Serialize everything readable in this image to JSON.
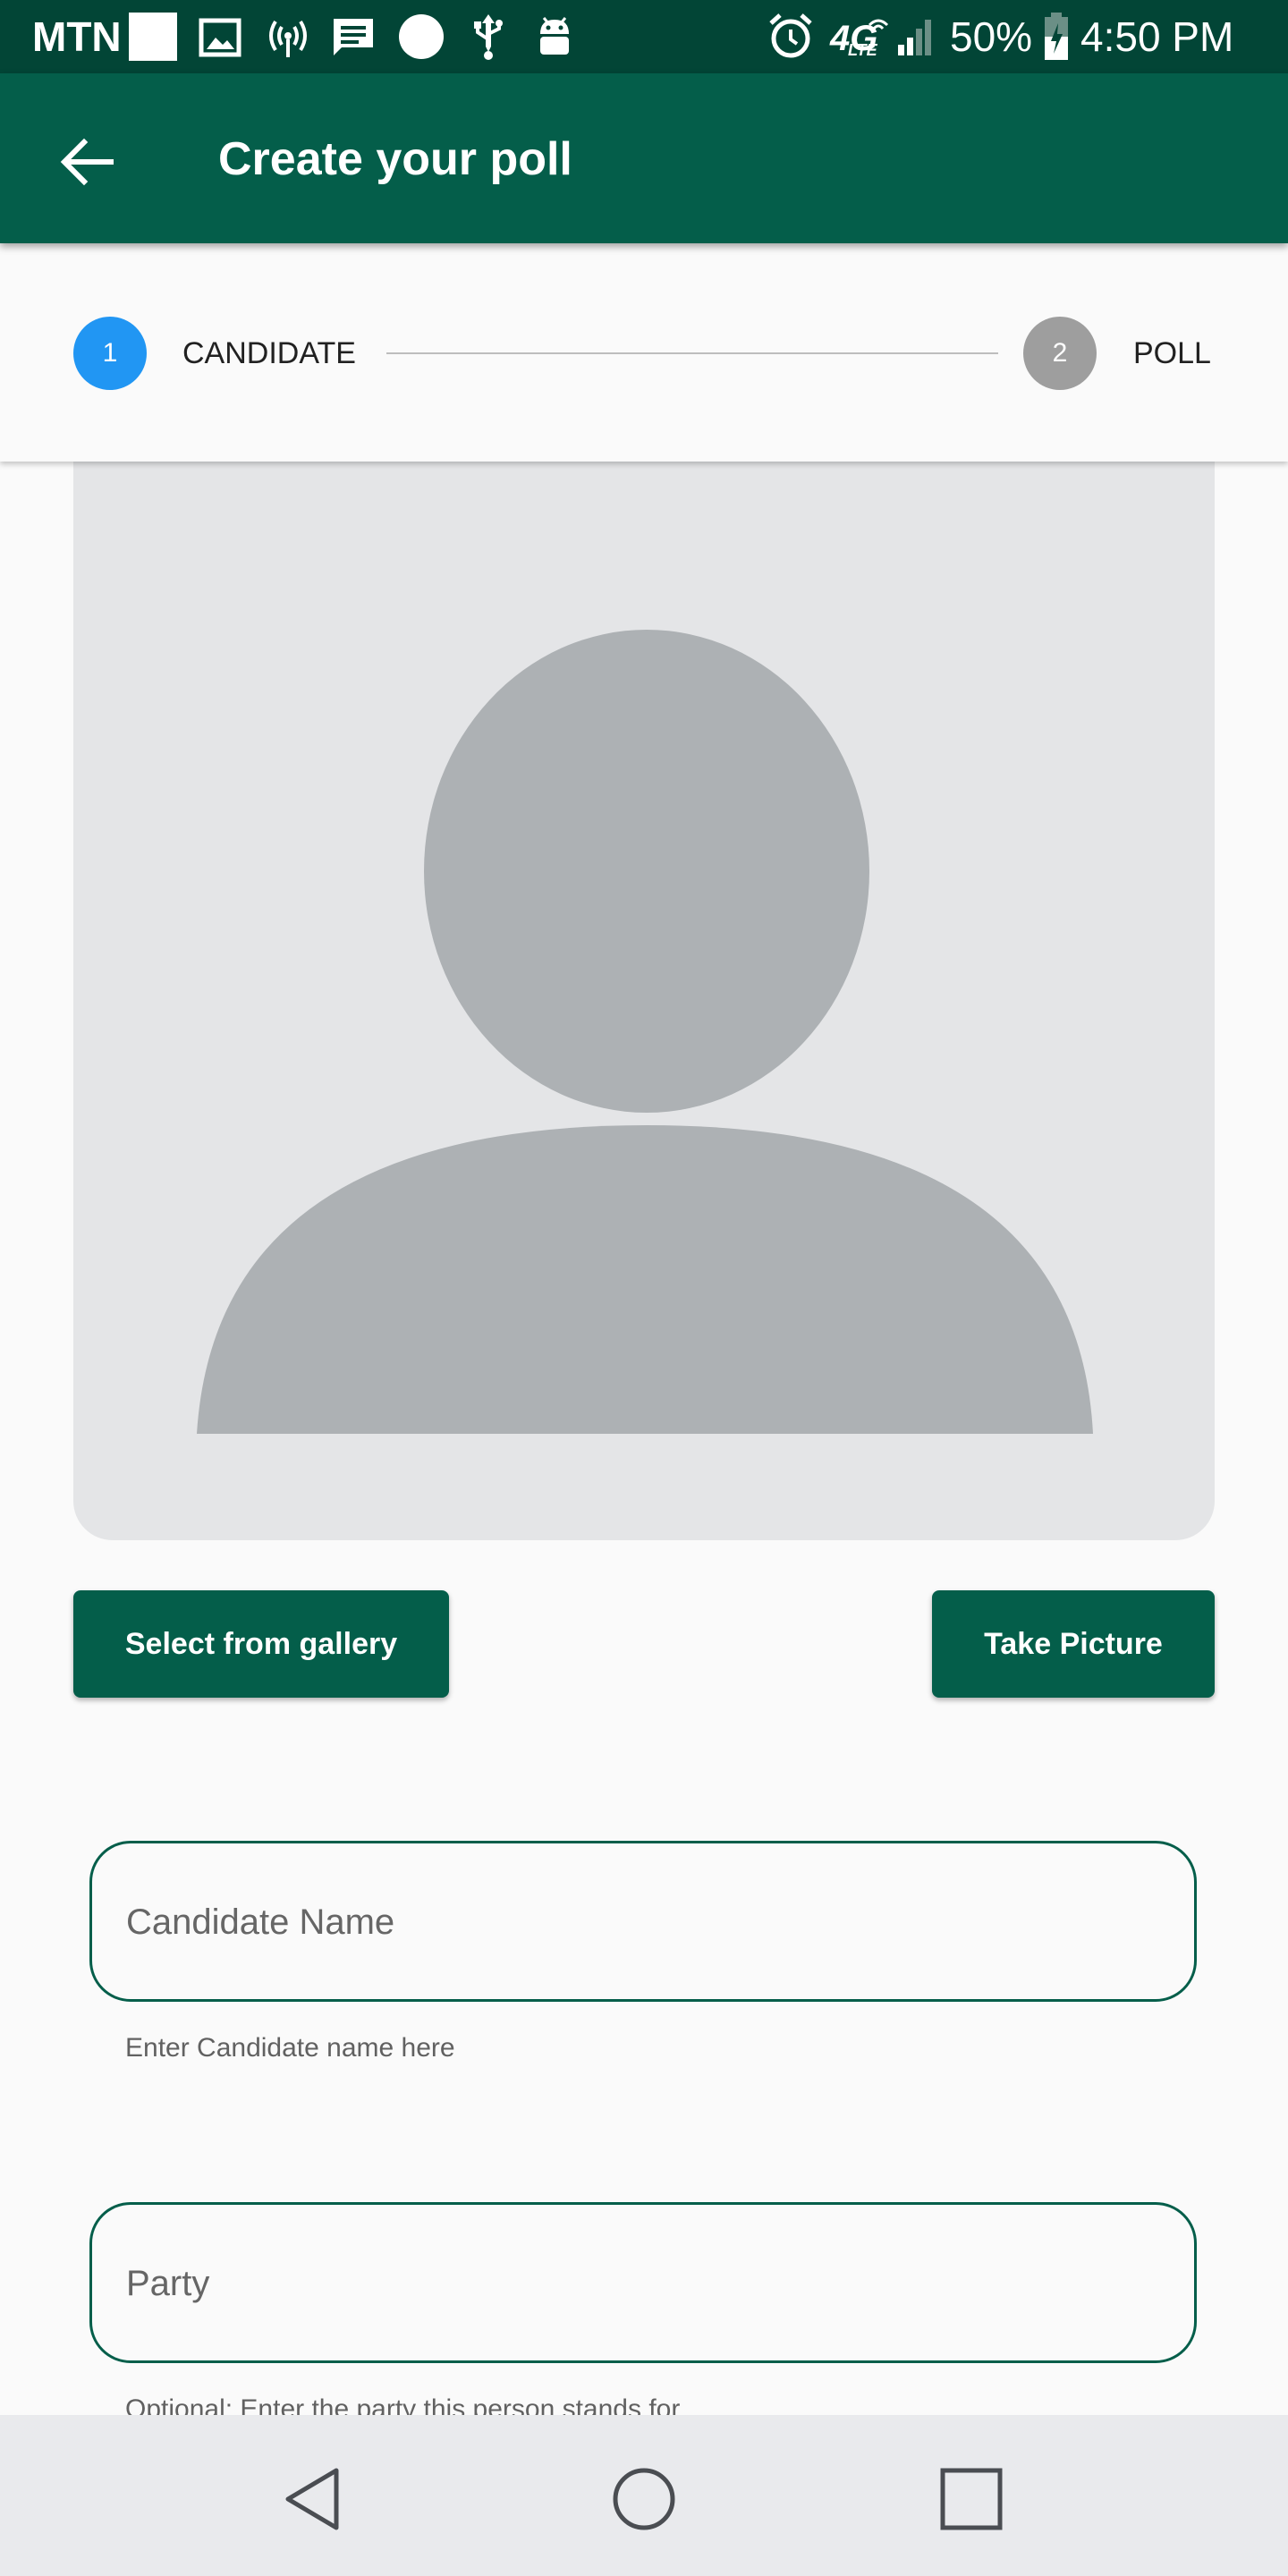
{
  "status_bar": {
    "carrier": "MTN",
    "network": "4G",
    "network_sub": "LTE",
    "battery": "50%",
    "time": "4:50 PM",
    "icons": [
      "square-notification-icon",
      "image-icon",
      "hotspot-icon",
      "message-icon",
      "circle-notification-icon",
      "usb-icon",
      "android-debug-icon",
      "alarm-icon",
      "lte-icon",
      "signal-icon",
      "battery-charging-icon"
    ]
  },
  "app_bar": {
    "title": "Create your poll",
    "back_icon": "arrow-back-icon",
    "background": "#045e4a"
  },
  "stepper": {
    "steps": [
      {
        "number": "1",
        "label": "CANDIDATE",
        "color": "#2196f3",
        "active": true
      },
      {
        "number": "2",
        "label": "POLL",
        "color": "#9e9e9e",
        "active": false
      }
    ]
  },
  "photo": {
    "placeholder_icon": "person-silhouette-icon",
    "background": "#e4e5e7",
    "silhouette_color": "#adb1b4"
  },
  "buttons": {
    "gallery": "Select from gallery",
    "camera": "Take Picture"
  },
  "form": {
    "candidate_name": {
      "placeholder": "Candidate Name",
      "helper": "Enter Candidate name here"
    },
    "party": {
      "placeholder": "Party",
      "helper": "Optional: Enter the party this person stands for"
    }
  },
  "nav_bar": {
    "icons": [
      "back-triangle-icon",
      "home-circle-icon",
      "recents-square-icon"
    ]
  },
  "colors": {
    "status_bar": "#024536",
    "primary": "#045e4a",
    "accent": "#2196f3"
  }
}
